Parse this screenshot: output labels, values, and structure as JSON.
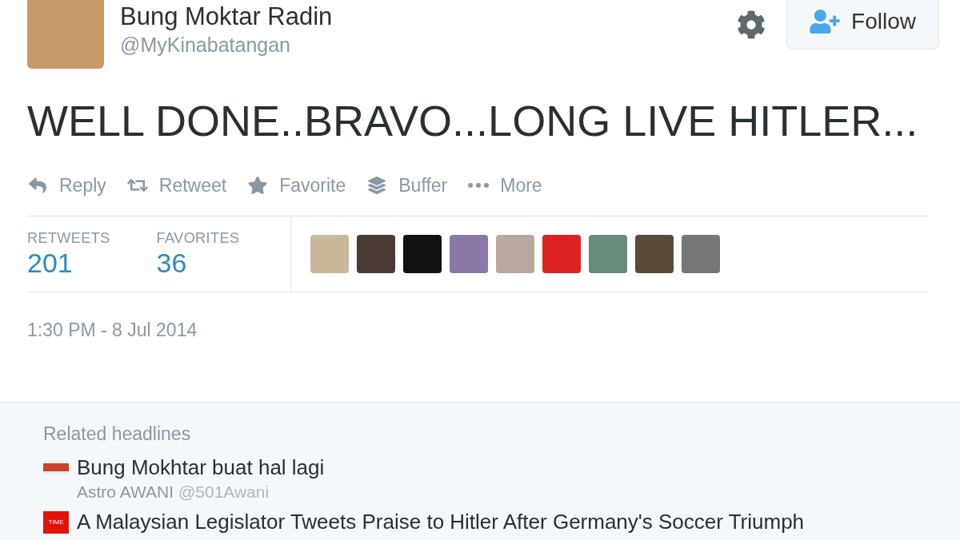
{
  "author": {
    "name": "Bung Moktar Radin",
    "handle": "@MyKinabatangan"
  },
  "follow_button": {
    "label": "Follow"
  },
  "tweet_text": "WELL DONE..BRAVO...LONG LIVE HITLER...",
  "actions": [
    {
      "kind": "reply",
      "label": "Reply"
    },
    {
      "kind": "retweet",
      "label": "Retweet"
    },
    {
      "kind": "favorite",
      "label": "Favorite"
    },
    {
      "kind": "buffer",
      "label": "Buffer"
    },
    {
      "kind": "more",
      "label": "More"
    }
  ],
  "stats": [
    {
      "label": "RETWEETS",
      "value": "201"
    },
    {
      "label": "FAVORITES",
      "value": "36"
    }
  ],
  "timestamp": "1:30 PM - 8 Jul 2014",
  "related": {
    "title": "Related headlines",
    "headlines": [
      {
        "kind": "awani",
        "title": "Bung Mokhtar buat hal lagi",
        "source": "Astro AWANI",
        "source_handle": "@501Awani"
      },
      {
        "kind": "time",
        "logo_text": "TIME",
        "title": "A Malaysian Legislator Tweets Praise to Hitler After Germany's Soccer Triumph"
      }
    ]
  }
}
